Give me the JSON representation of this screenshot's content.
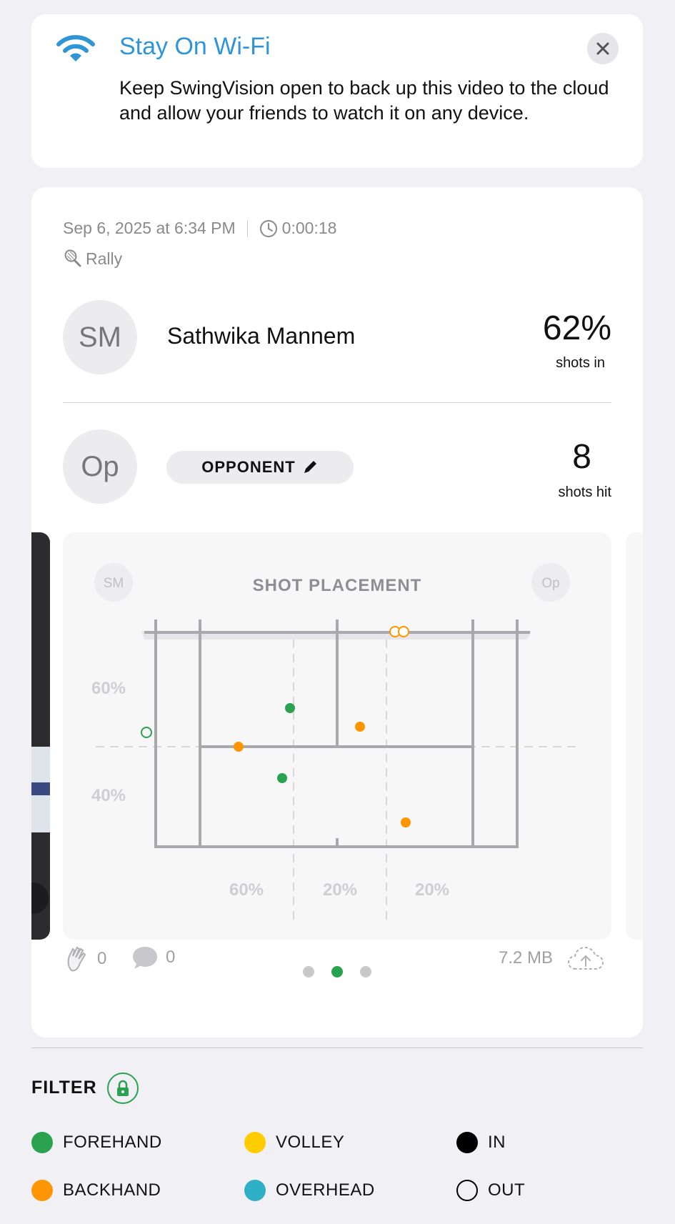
{
  "banner": {
    "title": "Stay On Wi-Fi",
    "body": "Keep SwingVision open to back up this video to the cloud and allow your friends to watch it on any device."
  },
  "session": {
    "date": "Sep 6, 2025 at 6:34 PM",
    "duration": "0:00:18",
    "mode": "Rally"
  },
  "player": {
    "initials": "SM",
    "name": "Sathwika Mannem",
    "stat_value": "62%",
    "stat_label": "shots in"
  },
  "opponent": {
    "initials": "Op",
    "pill_label": "OPPONENT",
    "stat_value": "8",
    "stat_label": "shots hit"
  },
  "placement": {
    "title": "SHOT PLACEMENT",
    "left_badge": "SM",
    "right_badge": "Op",
    "row_pcts": [
      "60%",
      "40%"
    ],
    "col_pcts": [
      "60%",
      "20%",
      "20%"
    ]
  },
  "footer": {
    "claps": "0",
    "comments": "0",
    "size": "7.2 MB",
    "pages": 3,
    "active_page": 1
  },
  "filter": {
    "title": "FILTER",
    "items": [
      {
        "label": "FOREHAND",
        "color": "#2aa24f",
        "style": "fill"
      },
      {
        "label": "VOLLEY",
        "color": "#ffcc00",
        "style": "fill"
      },
      {
        "label": "IN",
        "color": "#000000",
        "style": "fill"
      },
      {
        "label": "BACKHAND",
        "color": "#ff9500",
        "style": "fill"
      },
      {
        "label": "OVERHEAD",
        "color": "#30b0c7",
        "style": "fill"
      },
      {
        "label": "OUT",
        "color": "#000000",
        "style": "outline"
      }
    ]
  },
  "colors": {
    "forehand": "#2aa24f",
    "backhand": "#ff9500",
    "accent": "#2f95d6"
  }
}
